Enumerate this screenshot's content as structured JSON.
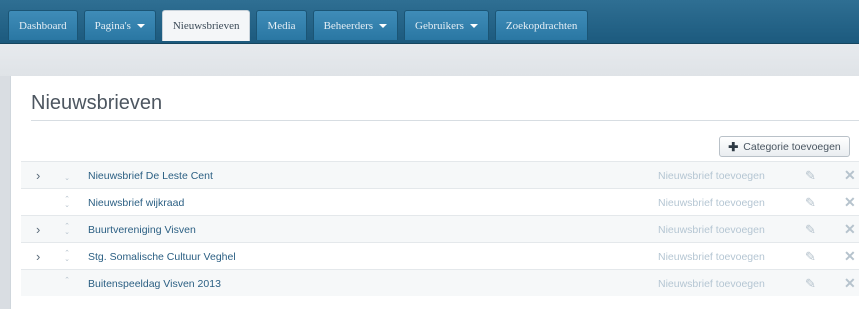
{
  "nav": {
    "tabs": [
      {
        "label": "Dashboard",
        "dropdown": false,
        "active": false
      },
      {
        "label": "Pagina's",
        "dropdown": true,
        "active": false
      },
      {
        "label": "Nieuwsbrieven",
        "dropdown": false,
        "active": true
      },
      {
        "label": "Media",
        "dropdown": false,
        "active": false
      },
      {
        "label": "Beheerders",
        "dropdown": true,
        "active": false
      },
      {
        "label": "Gebruikers",
        "dropdown": true,
        "active": false
      },
      {
        "label": "Zoekopdrachten",
        "dropdown": false,
        "active": false
      }
    ]
  },
  "page": {
    "title": "Nieuwsbrieven",
    "add_category_label": "Categorie toevoegen"
  },
  "list": {
    "rows": [
      {
        "name": "Nieuwsbrief De Leste Cent",
        "link": "Nieuwsbrief toevoegen",
        "expandable": true,
        "sort": "down"
      },
      {
        "name": "Nieuwsbrief wijkraad",
        "link": "Nieuwsbrief toevoegen",
        "expandable": false,
        "sort": "updown"
      },
      {
        "name": "Buurtvereniging Visven",
        "link": "Nieuwsbrief toevoegen",
        "expandable": true,
        "sort": "updown"
      },
      {
        "name": "Stg. Somalische Cultuur Veghel",
        "link": "Nieuwsbrief toevoegen",
        "expandable": true,
        "sort": "updown"
      },
      {
        "name": "Buitenspeeldag Visven 2013",
        "link": "Nieuwsbrief toevoegen",
        "expandable": false,
        "sort": "up"
      }
    ]
  },
  "icons": {
    "expand": "chevron-right-icon",
    "edit": "pencil-icon",
    "delete": "close-icon",
    "add": "plus-icon"
  },
  "colors": {
    "navbar": "#1c5a7e",
    "tab": "#3f8cb8",
    "link": "#2b5f83",
    "muted": "#b5c6d3"
  }
}
